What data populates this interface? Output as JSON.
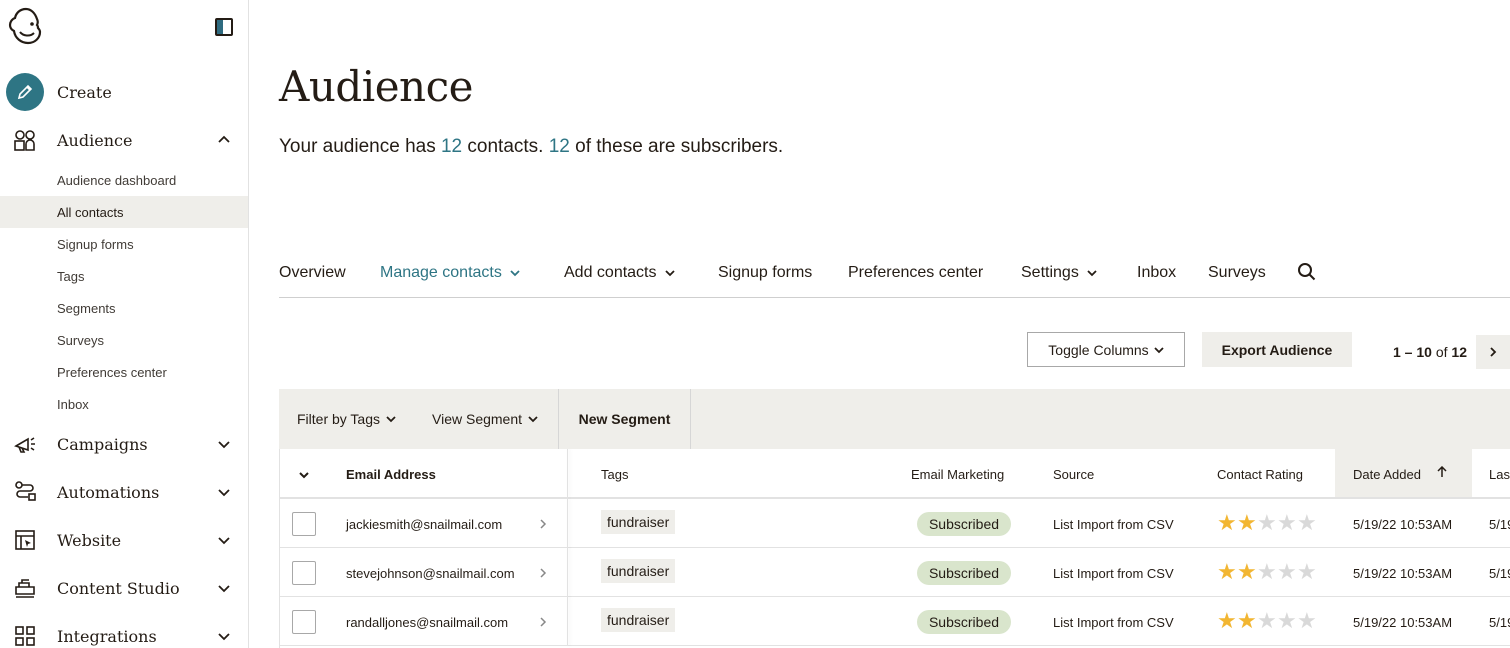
{
  "sidebar": {
    "create_label": "Create",
    "audience_label": "Audience",
    "audience_items": [
      {
        "label": "Audience dashboard",
        "active": false
      },
      {
        "label": "All contacts",
        "active": true
      },
      {
        "label": "Signup forms",
        "active": false
      },
      {
        "label": "Tags",
        "active": false
      },
      {
        "label": "Segments",
        "active": false
      },
      {
        "label": "Surveys",
        "active": false
      },
      {
        "label": "Preferences center",
        "active": false
      },
      {
        "label": "Inbox",
        "active": false
      }
    ],
    "campaigns_label": "Campaigns",
    "automations_label": "Automations",
    "website_label": "Website",
    "content_studio_label": "Content Studio",
    "integrations_label": "Integrations"
  },
  "header": {
    "title": "Audience",
    "subtitle_prefix": "Your audience has ",
    "contact_count": "12",
    "subtitle_mid": " contacts. ",
    "subscriber_count": "12",
    "subtitle_suffix": " of these are subscribers."
  },
  "tabs": {
    "overview": "Overview",
    "manage_contacts": "Manage contacts",
    "add_contacts": "Add contacts",
    "signup_forms": "Signup forms",
    "preferences_center": "Preferences center",
    "settings": "Settings",
    "inbox": "Inbox",
    "surveys": "Surveys"
  },
  "toolbar": {
    "toggle_columns": "Toggle Columns",
    "export_audience": "Export Audience",
    "pager_range": "1 – 10",
    "pager_of": " of ",
    "pager_total": "12"
  },
  "filters": {
    "filter_by_tags": "Filter by Tags",
    "view_segment": "View Segment",
    "new_segment": "New Segment"
  },
  "table": {
    "columns": {
      "email": "Email Address",
      "tags": "Tags",
      "email_marketing": "Email Marketing",
      "source": "Source",
      "contact_rating": "Contact Rating",
      "date_added": "Date Added",
      "last_changed": "Las"
    },
    "rows": [
      {
        "email": "jackiesmith@snailmail.com",
        "tag": "fundraiser",
        "status": "Subscribed",
        "source": "List Import from CSV",
        "rating": 2,
        "date_added": "5/19/22 10:53AM",
        "last_changed": "5/19"
      },
      {
        "email": "stevejohnson@snailmail.com",
        "tag": "fundraiser",
        "status": "Subscribed",
        "source": "List Import from CSV",
        "rating": 2,
        "date_added": "5/19/22 10:53AM",
        "last_changed": "5/19"
      },
      {
        "email": "randalljones@snailmail.com",
        "tag": "fundraiser",
        "status": "Subscribed",
        "source": "List Import from CSV",
        "rating": 2,
        "date_added": "5/19/22 10:53AM",
        "last_changed": "5/19"
      }
    ]
  },
  "colors": {
    "accent": "#2e7584",
    "star_on": "#f2b632",
    "star_off": "#d9d9d9",
    "badge_bg": "#d9e5cc",
    "panel_bg": "#efeeea"
  }
}
